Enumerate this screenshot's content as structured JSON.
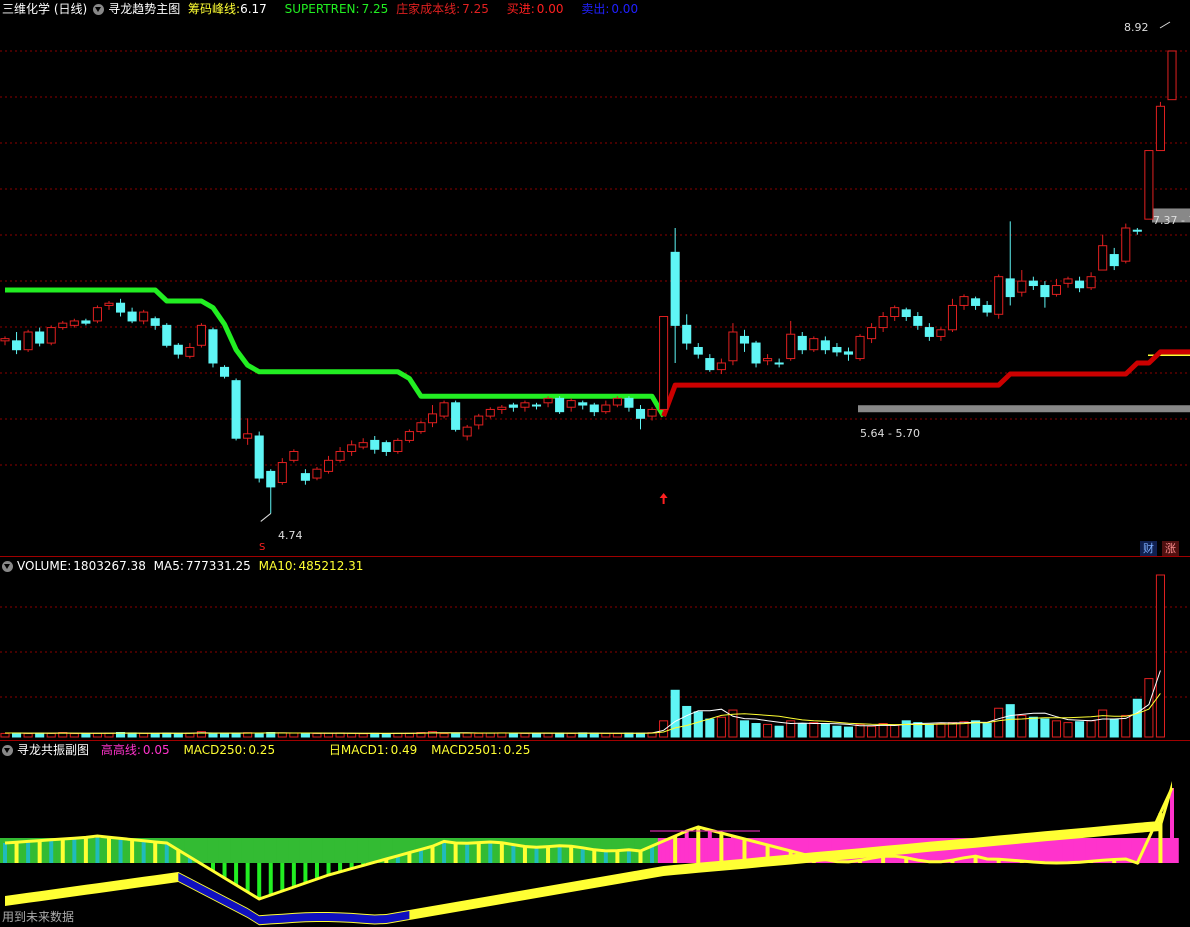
{
  "colors": {
    "up": "#e02020",
    "down": "#5ff5f5",
    "green_line": "#22ee22",
    "red_line": "#cc0000",
    "yellow": "#ffff33",
    "magenta": "#ff33cc",
    "blue": "#1010c0",
    "grid": "#8b0000",
    "gray": "#888888"
  },
  "main": {
    "title": "三维化学 (日线)",
    "indicator": "寻龙趋势主图",
    "chip_label": "筹码峰线:",
    "chip_value": "6.17",
    "supertrend_label": "SUPERTREN:",
    "supertrend_value": "7.25",
    "cost_label": "庄家成本线:",
    "cost_value": "7.25",
    "buy_label": "买进:",
    "buy_value": "0.00",
    "sell_label": "卖出:",
    "sell_value": "0.00",
    "high_label": "8.92",
    "low_label": "4.74",
    "range_label_1": "7.37 - 7",
    "range_label_2": "5.64 - 5.70",
    "badge_finance": "财",
    "badge_limit": "涨",
    "signal_s": "S",
    "signal_b": "B"
  },
  "volume": {
    "label": "VOLUME:",
    "value": "1803267.38",
    "ma5_label": "MA5:",
    "ma5_value": "777331.25",
    "ma10_label": "MA10:",
    "ma10_value": "485212.31"
  },
  "sub": {
    "title": "寻龙共振副图",
    "peak_label": "高高线:",
    "peak_value": "0.05",
    "macd250_label": "MACD250:",
    "macd250_value": "0.25",
    "macd1_label": "日MACD1:",
    "macd1_value": "0.49",
    "macd2501_label": "MACD2501:",
    "macd2501_value": "0.25"
  },
  "footer": "用到未来数据",
  "chart_data": {
    "type": "candlestick",
    "y_range": [
      4.5,
      9.2
    ],
    "candles": [
      [
        6.3,
        6.32,
        6.26,
        6.34,
        1
      ],
      [
        6.3,
        6.22,
        6.18,
        6.38,
        0
      ],
      [
        6.22,
        6.38,
        6.2,
        6.4,
        1
      ],
      [
        6.38,
        6.28,
        6.25,
        6.42,
        0
      ],
      [
        6.28,
        6.42,
        6.26,
        6.44,
        1
      ],
      [
        6.42,
        6.46,
        6.4,
        6.48,
        1
      ],
      [
        6.44,
        6.48,
        6.42,
        6.5,
        1
      ],
      [
        6.48,
        6.46,
        6.44,
        6.5,
        0
      ],
      [
        6.48,
        6.6,
        6.46,
        6.62,
        1
      ],
      [
        6.62,
        6.64,
        6.58,
        6.66,
        1
      ],
      [
        6.64,
        6.56,
        6.52,
        6.68,
        0
      ],
      [
        6.56,
        6.48,
        6.46,
        6.6,
        0
      ],
      [
        6.48,
        6.56,
        6.45,
        6.58,
        1
      ],
      [
        6.5,
        6.44,
        6.4,
        6.52,
        0
      ],
      [
        6.44,
        6.26,
        6.24,
        6.46,
        0
      ],
      [
        6.26,
        6.18,
        6.14,
        6.28,
        0
      ],
      [
        6.16,
        6.24,
        6.14,
        6.28,
        1
      ],
      [
        6.26,
        6.44,
        6.24,
        6.46,
        1
      ],
      [
        6.4,
        6.1,
        6.06,
        6.42,
        0
      ],
      [
        6.06,
        5.98,
        5.96,
        6.08,
        0
      ],
      [
        5.94,
        5.42,
        5.4,
        5.96,
        0
      ],
      [
        5.42,
        5.46,
        5.36,
        5.6,
        1
      ],
      [
        5.44,
        5.06,
        5.02,
        5.48,
        0
      ],
      [
        5.12,
        4.98,
        4.74,
        5.14,
        0
      ],
      [
        5.02,
        5.2,
        5.0,
        5.24,
        1
      ],
      [
        5.22,
        5.3,
        5.2,
        5.32,
        1
      ],
      [
        5.1,
        5.04,
        5.0,
        5.14,
        0
      ],
      [
        5.06,
        5.14,
        5.04,
        5.16,
        1
      ],
      [
        5.12,
        5.22,
        5.1,
        5.26,
        1
      ],
      [
        5.22,
        5.3,
        5.2,
        5.34,
        1
      ],
      [
        5.3,
        5.36,
        5.26,
        5.4,
        1
      ],
      [
        5.34,
        5.38,
        5.32,
        5.42,
        1
      ],
      [
        5.4,
        5.32,
        5.28,
        5.44,
        0
      ],
      [
        5.38,
        5.3,
        5.26,
        5.4,
        0
      ],
      [
        5.3,
        5.4,
        5.28,
        5.42,
        1
      ],
      [
        5.4,
        5.48,
        5.38,
        5.5,
        1
      ],
      [
        5.48,
        5.56,
        5.46,
        5.58,
        1
      ],
      [
        5.56,
        5.64,
        5.52,
        5.72,
        1
      ],
      [
        5.62,
        5.74,
        5.6,
        5.76,
        1
      ],
      [
        5.74,
        5.5,
        5.48,
        5.76,
        0
      ],
      [
        5.44,
        5.52,
        5.4,
        5.54,
        1
      ],
      [
        5.54,
        5.62,
        5.5,
        5.64,
        1
      ],
      [
        5.62,
        5.68,
        5.6,
        5.7,
        1
      ],
      [
        5.68,
        5.7,
        5.64,
        5.72,
        1
      ],
      [
        5.72,
        5.7,
        5.66,
        5.74,
        0
      ],
      [
        5.7,
        5.74,
        5.66,
        5.76,
        1
      ],
      [
        5.72,
        5.72,
        5.68,
        5.74,
        0
      ],
      [
        5.74,
        5.78,
        5.7,
        5.8,
        1
      ],
      [
        5.78,
        5.66,
        5.64,
        5.8,
        0
      ],
      [
        5.7,
        5.76,
        5.66,
        5.78,
        1
      ],
      [
        5.74,
        5.72,
        5.68,
        5.76,
        0
      ],
      [
        5.72,
        5.66,
        5.62,
        5.74,
        0
      ],
      [
        5.66,
        5.72,
        5.64,
        5.76,
        1
      ],
      [
        5.72,
        5.78,
        5.7,
        5.8,
        1
      ],
      [
        5.78,
        5.7,
        5.66,
        5.8,
        0
      ],
      [
        5.68,
        5.6,
        5.5,
        5.72,
        0
      ],
      [
        5.62,
        5.68,
        5.58,
        5.7,
        1
      ],
      [
        5.68,
        6.52,
        5.66,
        6.52,
        1
      ],
      [
        6.44,
        7.1,
        6.1,
        7.32,
        0
      ],
      [
        6.44,
        6.28,
        6.22,
        6.54,
        0
      ],
      [
        6.24,
        6.18,
        6.14,
        6.28,
        0
      ],
      [
        6.14,
        6.04,
        6.02,
        6.18,
        0
      ],
      [
        6.04,
        6.1,
        6.0,
        6.14,
        1
      ],
      [
        6.12,
        6.38,
        6.08,
        6.46,
        1
      ],
      [
        6.34,
        6.28,
        6.2,
        6.4,
        0
      ],
      [
        6.28,
        6.1,
        6.06,
        6.3,
        0
      ],
      [
        6.12,
        6.14,
        6.08,
        6.18,
        1
      ],
      [
        6.1,
        6.1,
        6.06,
        6.14,
        0
      ],
      [
        6.14,
        6.36,
        6.12,
        6.48,
        1
      ],
      [
        6.34,
        6.22,
        6.18,
        6.38,
        0
      ],
      [
        6.22,
        6.32,
        6.2,
        6.34,
        1
      ],
      [
        6.3,
        6.22,
        6.18,
        6.34,
        0
      ],
      [
        6.24,
        6.2,
        6.16,
        6.28,
        0
      ],
      [
        6.2,
        6.18,
        6.12,
        6.24,
        0
      ],
      [
        6.14,
        6.34,
        6.12,
        6.36,
        1
      ],
      [
        6.32,
        6.42,
        6.28,
        6.46,
        1
      ],
      [
        6.42,
        6.52,
        6.38,
        6.56,
        1
      ],
      [
        6.52,
        6.6,
        6.48,
        6.62,
        1
      ],
      [
        6.58,
        6.52,
        6.48,
        6.6,
        0
      ],
      [
        6.52,
        6.44,
        6.4,
        6.56,
        0
      ],
      [
        6.42,
        6.34,
        6.3,
        6.46,
        0
      ],
      [
        6.34,
        6.4,
        6.3,
        6.42,
        1
      ],
      [
        6.4,
        6.62,
        6.38,
        6.68,
        1
      ],
      [
        6.62,
        6.7,
        6.58,
        6.72,
        1
      ],
      [
        6.68,
        6.62,
        6.58,
        6.7,
        0
      ],
      [
        6.62,
        6.56,
        6.52,
        6.66,
        0
      ],
      [
        6.54,
        6.88,
        6.5,
        6.9,
        1
      ],
      [
        6.86,
        6.7,
        6.62,
        7.38,
        0
      ],
      [
        6.74,
        6.84,
        6.7,
        6.94,
        1
      ],
      [
        6.84,
        6.8,
        6.76,
        6.88,
        0
      ],
      [
        6.8,
        6.7,
        6.6,
        6.84,
        0
      ],
      [
        6.72,
        6.8,
        6.7,
        6.86,
        1
      ],
      [
        6.82,
        6.86,
        6.78,
        6.88,
        1
      ],
      [
        6.84,
        6.78,
        6.74,
        6.88,
        0
      ],
      [
        6.78,
        6.88,
        6.76,
        6.92,
        1
      ],
      [
        6.94,
        7.16,
        6.94,
        7.26,
        1
      ],
      [
        7.08,
        6.98,
        6.94,
        7.14,
        0
      ],
      [
        7.02,
        7.32,
        7.0,
        7.36,
        1
      ],
      [
        7.3,
        7.3,
        7.26,
        7.32,
        0
      ],
      [
        7.4,
        8.02,
        7.4,
        8.02,
        1
      ],
      [
        8.02,
        8.42,
        8.02,
        8.46,
        1
      ],
      [
        8.48,
        8.92,
        8.48,
        8.92,
        1
      ]
    ],
    "green_line": [
      6.76,
      6.76,
      6.76,
      6.76,
      6.76,
      6.76,
      6.76,
      6.76,
      6.76,
      6.76,
      6.76,
      6.76,
      6.76,
      6.76,
      6.66,
      6.66,
      6.66,
      6.66,
      6.6,
      6.45,
      6.22,
      6.08,
      6.02,
      6.02,
      6.02,
      6.02,
      6.02,
      6.02,
      6.02,
      6.02,
      6.02,
      6.02,
      6.02,
      6.02,
      6.02,
      5.96,
      5.8,
      5.8,
      5.8,
      5.8,
      5.8,
      5.8,
      5.8,
      5.8,
      5.8,
      5.8,
      5.8,
      5.8,
      5.8,
      5.8,
      5.8,
      5.8,
      5.8,
      5.8,
      5.8,
      5.8,
      5.8,
      5.62
    ],
    "red_line_start": 57,
    "red_line": [
      5.62,
      5.9,
      5.9,
      5.9,
      5.9,
      5.9,
      5.9,
      5.9,
      5.9,
      5.9,
      5.9,
      5.9,
      5.9,
      5.9,
      5.9,
      5.9,
      5.9,
      5.9,
      5.9,
      5.9,
      5.9,
      5.9,
      5.9,
      5.9,
      5.9,
      5.9,
      5.9,
      5.9,
      5.9,
      5.9,
      6.0,
      6.0,
      6.0,
      6.0,
      6.0,
      6.0,
      6.0,
      6.0,
      6.0,
      6.0,
      6.0,
      6.1,
      6.1,
      6.2,
      6.2,
      6.2,
      6.2,
      6.2,
      6.2,
      6.22,
      6.3,
      6.52,
      7.1,
      7.3,
      7.4
    ],
    "volume_max": 1803267.38,
    "volume": [
      40,
      45,
      38,
      42,
      40,
      50,
      38,
      36,
      40,
      42,
      50,
      45,
      40,
      38,
      42,
      40,
      44,
      60,
      38,
      36,
      42,
      48,
      40,
      50,
      46,
      44,
      40,
      38,
      42,
      45,
      40,
      36,
      40,
      38,
      40,
      42,
      50,
      60,
      38,
      40,
      42,
      40,
      44,
      46,
      42,
      40,
      38,
      42,
      44,
      40,
      46,
      42,
      40,
      38,
      44,
      42,
      48,
      180,
      520,
      340,
      280,
      200,
      220,
      300,
      180,
      150,
      140,
      120,
      180,
      150,
      160,
      140,
      120,
      110,
      140,
      120,
      150,
      130,
      180,
      160,
      140,
      150,
      160,
      170,
      180,
      150,
      320,
      360,
      240,
      220,
      200,
      180,
      160,
      170,
      180,
      300,
      200,
      240,
      420,
      650,
      1803
    ],
    "volume_ma5": [
      44,
      44,
      42,
      43,
      42,
      44,
      42,
      41,
      42,
      41,
      43,
      43,
      42,
      41,
      43,
      41,
      42,
      47,
      45,
      43,
      43,
      45,
      44,
      46,
      46,
      45,
      44,
      42,
      42,
      42,
      42,
      40,
      40,
      39,
      40,
      40,
      43,
      48,
      47,
      47,
      47,
      44,
      43,
      44,
      43,
      42,
      42,
      42,
      42,
      41,
      43,
      43,
      42,
      42,
      42,
      42,
      44,
      75,
      174,
      237,
      292,
      293,
      309,
      230,
      205,
      200,
      180,
      165,
      150,
      155,
      150,
      150,
      148,
      140,
      126,
      125,
      130,
      128,
      140,
      150,
      154,
      158,
      156,
      158,
      165,
      163,
      204,
      238,
      251,
      264,
      266,
      226,
      194,
      186,
      180,
      200,
      200,
      207,
      270,
      362,
      740
    ],
    "volume_ma10": [
      44,
      44,
      43,
      43,
      43,
      43,
      43,
      42,
      42,
      42,
      43,
      43,
      42,
      42,
      42,
      42,
      42,
      43,
      43,
      43,
      43,
      43,
      44,
      45,
      45,
      45,
      44,
      44,
      43,
      43,
      42,
      42,
      42,
      41,
      41,
      41,
      42,
      44,
      44,
      45,
      45,
      44,
      44,
      44,
      45,
      45,
      45,
      44,
      43,
      43,
      42,
      42,
      42,
      42,
      42,
      42,
      43,
      56,
      101,
      128,
      166,
      203,
      240,
      254,
      258,
      250,
      240,
      230,
      210,
      190,
      180,
      175,
      164,
      152,
      148,
      142,
      140,
      138,
      140,
      138,
      140,
      144,
      145,
      149,
      158,
      158,
      180,
      196,
      200,
      208,
      215,
      215,
      214,
      219,
      226,
      238,
      232,
      230,
      260,
      310,
      485
    ]
  }
}
